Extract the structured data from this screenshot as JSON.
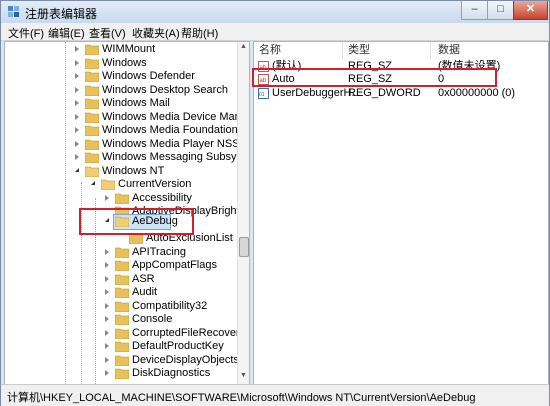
{
  "window": {
    "title": "注册表编辑器",
    "controls": {
      "minimize": "–",
      "maximize": "□",
      "close": "✕"
    }
  },
  "menubar": {
    "items": [
      "文件(F)",
      "编辑(E)",
      "查看(V)",
      "收藏夹(A)",
      "帮助(H)"
    ]
  },
  "tree": {
    "items": [
      {
        "label": "WIMMount"
      },
      {
        "label": "Windows"
      },
      {
        "label": "Windows Defender"
      },
      {
        "label": "Windows Desktop Search"
      },
      {
        "label": "Windows Mail"
      },
      {
        "label": "Windows Media Device Manager"
      },
      {
        "label": "Windows Media Foundation"
      },
      {
        "label": "Windows Media Player NSS"
      },
      {
        "label": "Windows Messaging Subsystem"
      },
      {
        "label": "Windows NT"
      },
      {
        "label": "CurrentVersion"
      },
      {
        "label": "Accessibility"
      },
      {
        "label": "AdaptiveDisplayBrightness"
      },
      {
        "label": "AeDebug"
      },
      {
        "label": "AutoExclusionList"
      },
      {
        "label": "APITracing"
      },
      {
        "label": "AppCompatFlags"
      },
      {
        "label": "ASR"
      },
      {
        "label": "Audit"
      },
      {
        "label": "Compatibility32"
      },
      {
        "label": "Console"
      },
      {
        "label": "CorruptedFileRecovery"
      },
      {
        "label": "DefaultProductKey"
      },
      {
        "label": "DeviceDisplayObjects"
      },
      {
        "label": "DiskDiagnostics"
      }
    ]
  },
  "list": {
    "headers": [
      "名称",
      "类型",
      "数据"
    ],
    "rows": [
      {
        "name": "(默认)",
        "type": "REG_SZ",
        "data": "(数值未设置)",
        "icon": "string-value-icon"
      },
      {
        "name": "Auto",
        "type": "REG_SZ",
        "data": "0",
        "icon": "string-value-icon"
      },
      {
        "name": "UserDebuggerH...",
        "type": "REG_DWORD",
        "data": "0x00000000 (0)",
        "icon": "binary-value-icon"
      }
    ]
  },
  "statusbar": {
    "path": "计算机\\HKEY_LOCAL_MACHINE\\SOFTWARE\\Microsoft\\Windows NT\\CurrentVersion\\AeDebug"
  },
  "colors": {
    "highlight": "#d21f2e",
    "folder": "#e9c15a",
    "selection": "#cce4f7"
  }
}
